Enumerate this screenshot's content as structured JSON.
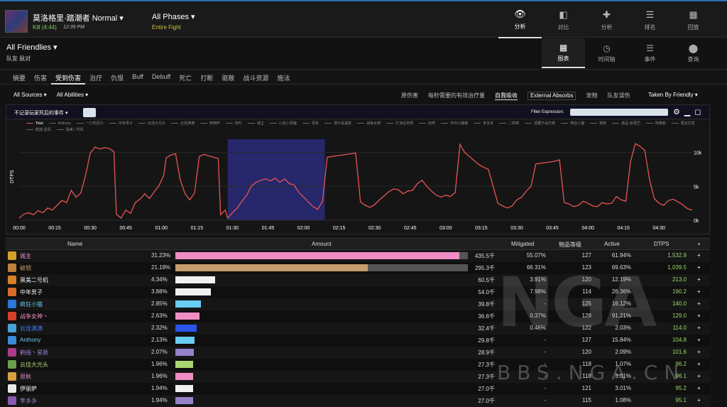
{
  "header": {
    "boss_name": "莫洛格里·踏潮者 Normal ▾",
    "kill": "Kill (4:44)",
    "kill_time": "12:39 PM",
    "phase": "All Phases ▾",
    "phase_sub": "Entire Fight",
    "nav": [
      {
        "label": "分析",
        "icon": "eye-icon",
        "glyph": "👁"
      },
      {
        "label": "对比",
        "icon": "compare-icon",
        "glyph": "◧"
      },
      {
        "label": "分析",
        "icon": "puzzle-icon",
        "glyph": "✚"
      },
      {
        "label": "排名",
        "icon": "ranking-icon",
        "glyph": "☰"
      },
      {
        "label": "回放",
        "icon": "replay-icon",
        "glyph": "▦"
      }
    ]
  },
  "subheader": {
    "title": "All Friendlies ▾",
    "sub": "队友   敌对",
    "nav": [
      {
        "label": "图表",
        "icon": "grid-icon",
        "glyph": "▦"
      },
      {
        "label": "时间轴",
        "icon": "clock-icon",
        "glyph": "◷"
      },
      {
        "label": "事件",
        "icon": "events-icon",
        "glyph": "☰"
      },
      {
        "label": "查询",
        "icon": "pin-icon",
        "glyph": "⬤"
      }
    ]
  },
  "tabs": [
    "摘要",
    "伤害",
    "受到伤害",
    "治疗",
    "仇恨",
    "Buff",
    "Debuff",
    "死亡",
    "打断",
    "驱散",
    "战斗资源",
    "施法"
  ],
  "filters": {
    "sources": "All Sources ▾",
    "abilities": "All Abilities ▾",
    "right": [
      "原伤害",
      "每秒需要的有效治疗量",
      "自我吸收",
      "External Absorbs",
      "宠物",
      "队友误伤"
    ],
    "taken_by": "Taken By Friendly ▾"
  },
  "panel": {
    "left_label": "不记录玩家死后的事件 ▾",
    "filter_label": "Filter Expression:",
    "icons": [
      "gear-icon",
      "minimize-icon",
      "maximize-icon"
    ],
    "legend": [
      "Total",
      "Anthony",
      "一口吃团子",
      "中年男子",
      "云佳大光头",
      "云佳满满",
      "伊丽萨",
      "四叮",
      "城主",
      "心有小恶魔",
      "思秋",
      "我不是温柔",
      "战争女神",
      "打油任务呢",
      "射草",
      "丰的小猪猪",
      "李多多",
      "二疯疯",
      "扭腰不会打散",
      "疯狂小猫",
      "破轫",
      "悬品·有尾巴",
      "阿莱斯",
      "顺云打机",
      "鹤摇·星辰",
      "黑美二号机"
    ]
  },
  "chart_data": {
    "type": "line",
    "ylabel": "DTPS",
    "x_ticks": [
      "00:00",
      "00:15",
      "00:30",
      "00:45",
      "01:00",
      "01:15",
      "01:30",
      "01:45",
      "02:00",
      "02:15",
      "02:30",
      "02:45",
      "03:00",
      "03:15",
      "03:30",
      "03:45",
      "04:00",
      "04:15",
      "04:30"
    ],
    "y_ticks": [
      "0k",
      "5k",
      "10k"
    ],
    "ylim": [
      0,
      13000
    ],
    "xlim": [
      0,
      284
    ],
    "highlight": [
      88,
      129
    ],
    "series": [
      {
        "name": "Total",
        "color": "#e85454",
        "points": [
          [
            0,
            300
          ],
          [
            2,
            900
          ],
          [
            4,
            1100
          ],
          [
            6,
            800
          ],
          [
            8,
            1400
          ],
          [
            10,
            1100
          ],
          [
            12,
            1800
          ],
          [
            14,
            1500
          ],
          [
            16,
            2200
          ],
          [
            18,
            2900
          ],
          [
            20,
            2600
          ],
          [
            22,
            4400
          ],
          [
            24,
            3400
          ],
          [
            26,
            4000
          ],
          [
            28,
            6600
          ],
          [
            30,
            9900
          ],
          [
            32,
            10800
          ],
          [
            34,
            10500
          ],
          [
            36,
            10700
          ],
          [
            38,
            10600
          ],
          [
            40,
            10100
          ],
          [
            41,
            900
          ],
          [
            43,
            300
          ],
          [
            45,
            1500
          ],
          [
            47,
            1000
          ],
          [
            49,
            2600
          ],
          [
            51,
            3100
          ],
          [
            53,
            3900
          ],
          [
            55,
            3200
          ],
          [
            57,
            4200
          ],
          [
            59,
            5100
          ],
          [
            61,
            6600
          ],
          [
            62,
            9200
          ],
          [
            64,
            9600
          ],
          [
            66,
            9800
          ],
          [
            68,
            5900
          ],
          [
            70,
            3900
          ],
          [
            72,
            3000
          ],
          [
            74,
            4000
          ],
          [
            76,
            9400
          ],
          [
            78,
            9700
          ],
          [
            80,
            9500
          ],
          [
            82,
            9300
          ],
          [
            84,
            9100
          ],
          [
            85,
            800
          ],
          [
            87,
            1500
          ],
          [
            88,
            300
          ],
          [
            90,
            1100
          ],
          [
            92,
            1800
          ],
          [
            94,
            2800
          ],
          [
            96,
            3700
          ],
          [
            98,
            5000
          ],
          [
            100,
            5600
          ],
          [
            102,
            5900
          ],
          [
            104,
            6100
          ],
          [
            106,
            5800
          ],
          [
            108,
            6200
          ],
          [
            110,
            5600
          ],
          [
            112,
            6100
          ],
          [
            114,
            5400
          ],
          [
            116,
            5200
          ],
          [
            118,
            4100
          ],
          [
            120,
            3400
          ],
          [
            122,
            2700
          ],
          [
            124,
            2000
          ],
          [
            126,
            1600
          ],
          [
            128,
            2800
          ],
          [
            130,
            9300
          ],
          [
            132,
            9400
          ],
          [
            134,
            9500
          ],
          [
            136,
            9600
          ],
          [
            138,
            9700
          ],
          [
            140,
            9800
          ],
          [
            142,
            9900
          ],
          [
            144,
            2700
          ],
          [
            146,
            2200
          ],
          [
            148,
            1900
          ],
          [
            150,
            2300
          ],
          [
            152,
            3000
          ],
          [
            154,
            3600
          ],
          [
            156,
            4200
          ],
          [
            158,
            4600
          ],
          [
            160,
            4500
          ],
          [
            162,
            3900
          ],
          [
            164,
            4300
          ],
          [
            166,
            4400
          ],
          [
            168,
            5400
          ],
          [
            170,
            5900
          ],
          [
            172,
            5000
          ],
          [
            174,
            4300
          ],
          [
            176,
            3700
          ],
          [
            178,
            3400
          ],
          [
            180,
            3700
          ],
          [
            182,
            3500
          ],
          [
            184,
            4100
          ],
          [
            186,
            11200
          ],
          [
            188,
            10000
          ],
          [
            190,
            9400
          ],
          [
            192,
            8800
          ],
          [
            194,
            8200
          ],
          [
            196,
            7800
          ],
          [
            198,
            7500
          ],
          [
            200,
            5000
          ],
          [
            202,
            2500
          ],
          [
            204,
            2100
          ],
          [
            206,
            1800
          ],
          [
            208,
            2100
          ],
          [
            210,
            3000
          ],
          [
            212,
            3400
          ],
          [
            214,
            4300
          ],
          [
            216,
            5000
          ],
          [
            218,
            8300
          ],
          [
            220,
            8400
          ],
          [
            222,
            8500
          ],
          [
            224,
            8600
          ],
          [
            226,
            8700
          ],
          [
            228,
            8900
          ],
          [
            230,
            2600
          ],
          [
            232,
            2400
          ],
          [
            234,
            2000
          ],
          [
            236,
            2200
          ],
          [
            238,
            2800
          ],
          [
            240,
            2500
          ],
          [
            242,
            2100
          ],
          [
            244,
            2000
          ],
          [
            246,
            2600
          ],
          [
            248,
            2400
          ],
          [
            250,
            2500
          ],
          [
            252,
            3500
          ],
          [
            254,
            3000
          ],
          [
            256,
            2800
          ],
          [
            258,
            8700
          ],
          [
            260,
            11300
          ],
          [
            262,
            10900
          ],
          [
            264,
            10300
          ],
          [
            266,
            6000
          ],
          [
            268,
            3200
          ],
          [
            270,
            2500
          ],
          [
            272,
            2200
          ],
          [
            274,
            2900
          ],
          [
            276,
            3100
          ],
          [
            278,
            2700
          ],
          [
            280,
            2300
          ],
          [
            282,
            1700
          ],
          [
            284,
            1500
          ]
        ]
      }
    ]
  },
  "table": {
    "headers": {
      "name": "Name",
      "amount": "Amount",
      "mitigated": "Mitigated",
      "ilvl": "物品等级",
      "active": "Active",
      "dtps": "DTPS",
      "plus": "+"
    },
    "rows": [
      {
        "name": "城主",
        "color": "#f08ec4",
        "pct": "31.23%",
        "fill": 1.0,
        "amount": "435.5千",
        "mitigated": "55.07%",
        "ilvl": "127",
        "active": "61.94%",
        "dtps": "1,532.9",
        "icon": "#d6a12a",
        "namecolor": "#f08ec4"
      },
      {
        "name": "破轫",
        "color": "#c69b6d",
        "pct": "21.18%",
        "fill": 0.678,
        "amount": "295.3千",
        "mitigated": "66.31%",
        "ilvl": "123",
        "active": "69.63%",
        "dtps": "1,039.5",
        "icon": "#c0803a",
        "namecolor": "#c69b6d"
      },
      {
        "name": "黑美二号机",
        "color": "#f0f0f0",
        "pct": "4.34%",
        "fill": 0.139,
        "amount": "60.5千",
        "mitigated": "3.91%",
        "ilvl": "120",
        "active": "12.19%",
        "dtps": "213.0",
        "icon": "#d9802a",
        "namecolor": "#f0f0f0"
      },
      {
        "name": "中年男子",
        "color": "#f0f0f0",
        "pct": "3.88%",
        "fill": 0.124,
        "amount": "54.0千",
        "mitigated": "7.98%",
        "ilvl": "114",
        "active": "26.36%",
        "dtps": "190.2",
        "icon": "#d96a2a",
        "namecolor": "#f0f0f0"
      },
      {
        "name": "疯狂小猫",
        "color": "#69ccf0",
        "pct": "2.85%",
        "fill": 0.091,
        "amount": "39.8千",
        "mitigated": "-",
        "ilvl": "125",
        "active": "16.12%",
        "dtps": "140.0",
        "icon": "#2a7ad9",
        "namecolor": "#69ccf0"
      },
      {
        "name": "战争女神丶",
        "color": "#f08ec4",
        "pct": "2.63%",
        "fill": 0.084,
        "amount": "36.6千",
        "mitigated": "0.37%",
        "ilvl": "128",
        "active": "91.21%",
        "dtps": "129.0",
        "icon": "#d9402a",
        "namecolor": "#f08ec4"
      },
      {
        "name": "云佳满满",
        "color": "#2a55e8",
        "pct": "2.32%",
        "fill": 0.074,
        "amount": "32.4千",
        "mitigated": "0.46%",
        "ilvl": "122",
        "active": "2.03%",
        "dtps": "114.0",
        "icon": "#4aa2d9",
        "namecolor": "#4a7af0"
      },
      {
        "name": "Anthony",
        "color": "#69ccf0",
        "pct": "2.13%",
        "fill": 0.068,
        "amount": "29.8千",
        "mitigated": "-",
        "ilvl": "127",
        "active": "15.84%",
        "dtps": "104.8",
        "icon": "#3a8ad9",
        "namecolor": "#69ccf0"
      },
      {
        "name": "鹤摇丶星辰",
        "color": "#9482c9",
        "pct": "2.07%",
        "fill": 0.066,
        "amount": "28.9千",
        "mitigated": "-",
        "ilvl": "120",
        "active": "2.09%",
        "dtps": "101.6",
        "icon": "#b03a8a",
        "namecolor": "#9482c9"
      },
      {
        "name": "云佳大光头",
        "color": "#abd473",
        "pct": "1.96%",
        "fill": 0.063,
        "amount": "27.3千",
        "mitigated": "-",
        "ilvl": "118",
        "active": "1.07%",
        "dtps": "96.2",
        "icon": "#6aa04a",
        "namecolor": "#abd473"
      },
      {
        "name": "思秋",
        "color": "#f08ec4",
        "pct": "1.96%",
        "fill": 0.063,
        "amount": "27.3千",
        "mitigated": "-",
        "ilvl": "118",
        "active": "3.01%",
        "dtps": "96.1",
        "icon": "#d9a040",
        "namecolor": "#f08ec4"
      },
      {
        "name": "伊丽萨",
        "color": "#f0f0f0",
        "pct": "1.94%",
        "fill": 0.062,
        "amount": "27.0千",
        "mitigated": "-",
        "ilvl": "121",
        "active": "3.01%",
        "dtps": "95.2",
        "icon": "#e8e8e8",
        "namecolor": "#f0f0f0"
      },
      {
        "name": "李多多",
        "color": "#9482c9",
        "pct": "1.94%",
        "fill": 0.062,
        "amount": "27.0千",
        "mitigated": "-",
        "ilvl": "115",
        "active": "1.08%",
        "dtps": "95.1",
        "icon": "#8a5ab0",
        "namecolor": "#9482c9"
      }
    ]
  },
  "watermark": {
    "big": "NGA",
    "small": "BBS.NGA.CN"
  }
}
